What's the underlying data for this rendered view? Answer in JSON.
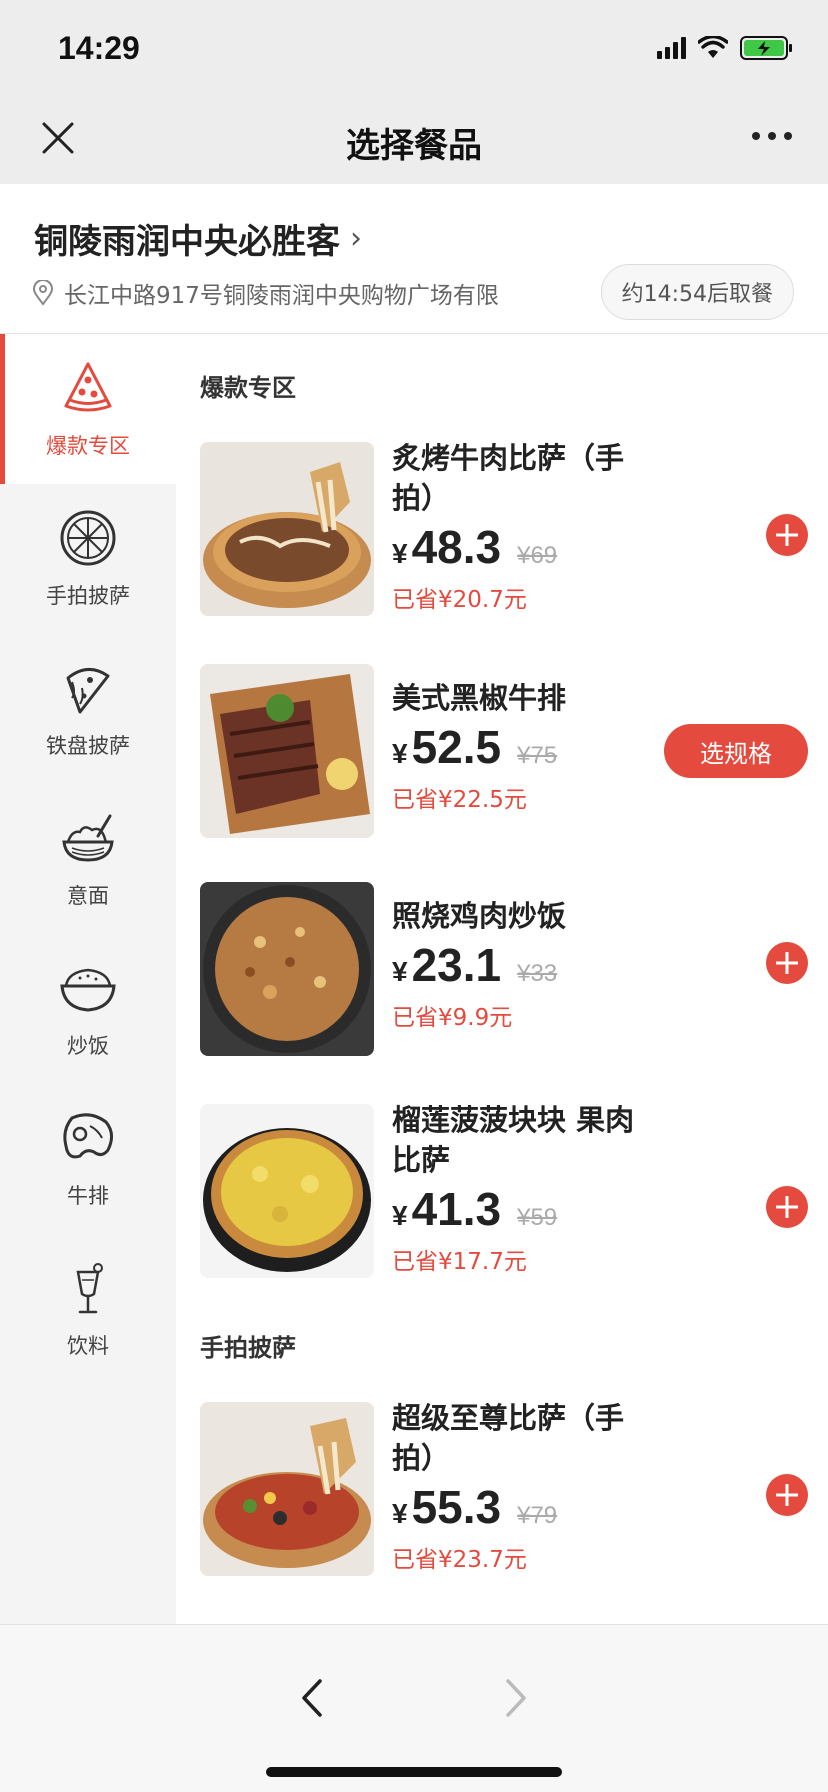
{
  "status": {
    "time": "14:29"
  },
  "nav": {
    "title": "选择餐品"
  },
  "store": {
    "name": "铜陵雨润中央必胜客",
    "address": "长江中路917号铜陵雨润中央购物广场有限",
    "pickup": "约14:54后取餐"
  },
  "sidebar": {
    "items": [
      {
        "label": "爆款专区",
        "icon": "pizza-slice-icon",
        "active": true
      },
      {
        "label": "手拍披萨",
        "icon": "whole-pizza-icon"
      },
      {
        "label": "铁盘披萨",
        "icon": "pizza-cheese-icon"
      },
      {
        "label": "意面",
        "icon": "pasta-bowl-icon"
      },
      {
        "label": "炒饭",
        "icon": "rice-bowl-icon"
      },
      {
        "label": "牛排",
        "icon": "steak-icon"
      },
      {
        "label": "饮料",
        "icon": "drink-glass-icon"
      }
    ]
  },
  "sections": [
    {
      "title": "爆款专区",
      "products": [
        {
          "name": "炙烤牛肉比萨（手拍）",
          "yen": "¥",
          "price": "48.3",
          "original": "¥69",
          "saved": "已省¥20.7元",
          "action": "add"
        },
        {
          "name": "美式黑椒牛排",
          "yen": "¥",
          "price": "52.5",
          "original": "¥75",
          "saved": "已省¥22.5元",
          "action": "spec",
          "action_label": "选规格"
        },
        {
          "name": "照烧鸡肉炒饭",
          "yen": "¥",
          "price": "23.1",
          "original": "¥33",
          "saved": "已省¥9.9元",
          "action": "add"
        },
        {
          "name": "榴莲菠菠块块 果肉比萨",
          "yen": "¥",
          "price": "41.3",
          "original": "¥59",
          "saved": "已省¥17.7元",
          "action": "add"
        }
      ]
    },
    {
      "title": "手拍披萨",
      "products": [
        {
          "name": "超级至尊比萨（手拍）",
          "yen": "¥",
          "price": "55.3",
          "original": "¥79",
          "saved": "已省¥23.7元",
          "action": "add"
        }
      ]
    }
  ],
  "colors": {
    "accent": "#e44b3e"
  }
}
